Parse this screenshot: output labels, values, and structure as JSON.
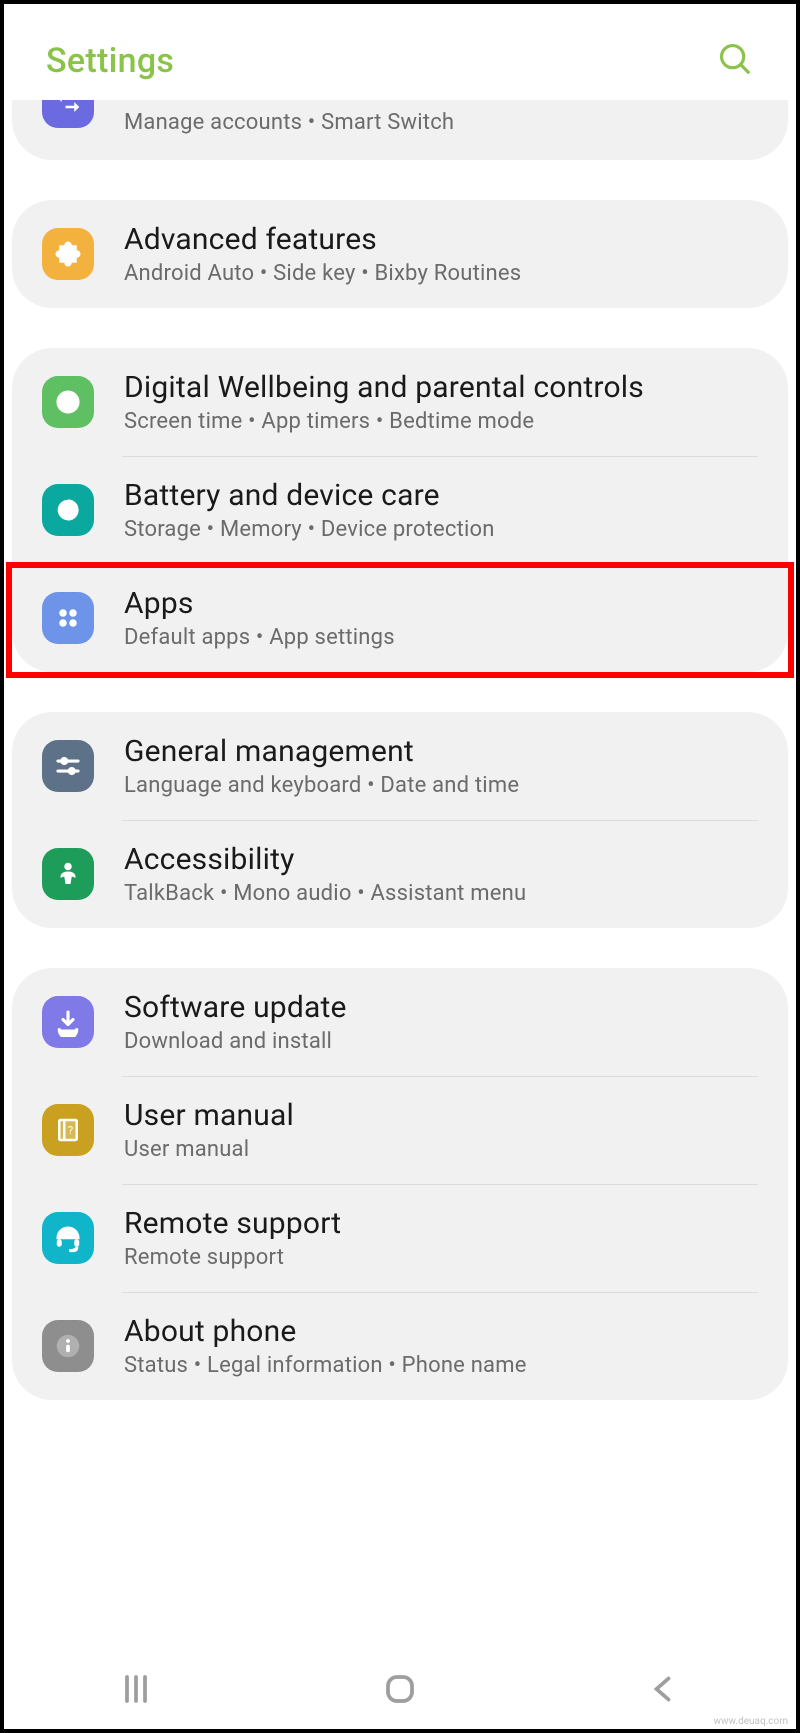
{
  "header": {
    "title": "Settings"
  },
  "groups": [
    {
      "partial": true,
      "items": [
        {
          "id": "accounts",
          "title": "",
          "sub": "Manage accounts  •  Smart Switch",
          "icon_color": "#6c6ae0",
          "icon": "swap"
        }
      ]
    },
    {
      "items": [
        {
          "id": "advanced",
          "title": "Advanced features",
          "sub": "Android Auto  •  Side key  •  Bixby Routines",
          "icon_color": "#f3b13e",
          "icon": "plus-puzzle"
        }
      ]
    },
    {
      "items": [
        {
          "id": "wellbeing",
          "title": "Digital Wellbeing and parental controls",
          "sub": "Screen time  •  App timers  •  Bedtime mode",
          "icon_color": "#5fbf63",
          "icon": "circle-heart"
        },
        {
          "id": "battery",
          "title": "Battery and device care",
          "sub": "Storage  •  Memory  •  Device protection",
          "icon_color": "#0aa89e",
          "icon": "care"
        },
        {
          "id": "apps",
          "title": "Apps",
          "sub": "Default apps  •  App settings",
          "icon_color": "#6d94e8",
          "icon": "grid4",
          "highlighted": true
        }
      ]
    },
    {
      "items": [
        {
          "id": "general",
          "title": "General management",
          "sub": "Language and keyboard  •  Date and time",
          "icon_color": "#5d7288",
          "icon": "sliders"
        },
        {
          "id": "accessibility",
          "title": "Accessibility",
          "sub": "TalkBack  •  Mono audio  •  Assistant menu",
          "icon_color": "#1e9c5a",
          "icon": "person"
        }
      ]
    },
    {
      "items": [
        {
          "id": "software",
          "title": "Software update",
          "sub": "Download and install",
          "icon_color": "#8079e8",
          "icon": "download"
        },
        {
          "id": "manual",
          "title": "User manual",
          "sub": "User manual",
          "icon_color": "#c9a01f",
          "icon": "book"
        },
        {
          "id": "remote",
          "title": "Remote support",
          "sub": "Remote support",
          "icon_color": "#10b5c9",
          "icon": "headset"
        },
        {
          "id": "about",
          "title": "About phone",
          "sub": "Status  •  Legal information  •  Phone name",
          "icon_color": "#8e8e8e",
          "icon": "info"
        }
      ]
    }
  ],
  "watermark": "www.deuaq.com"
}
